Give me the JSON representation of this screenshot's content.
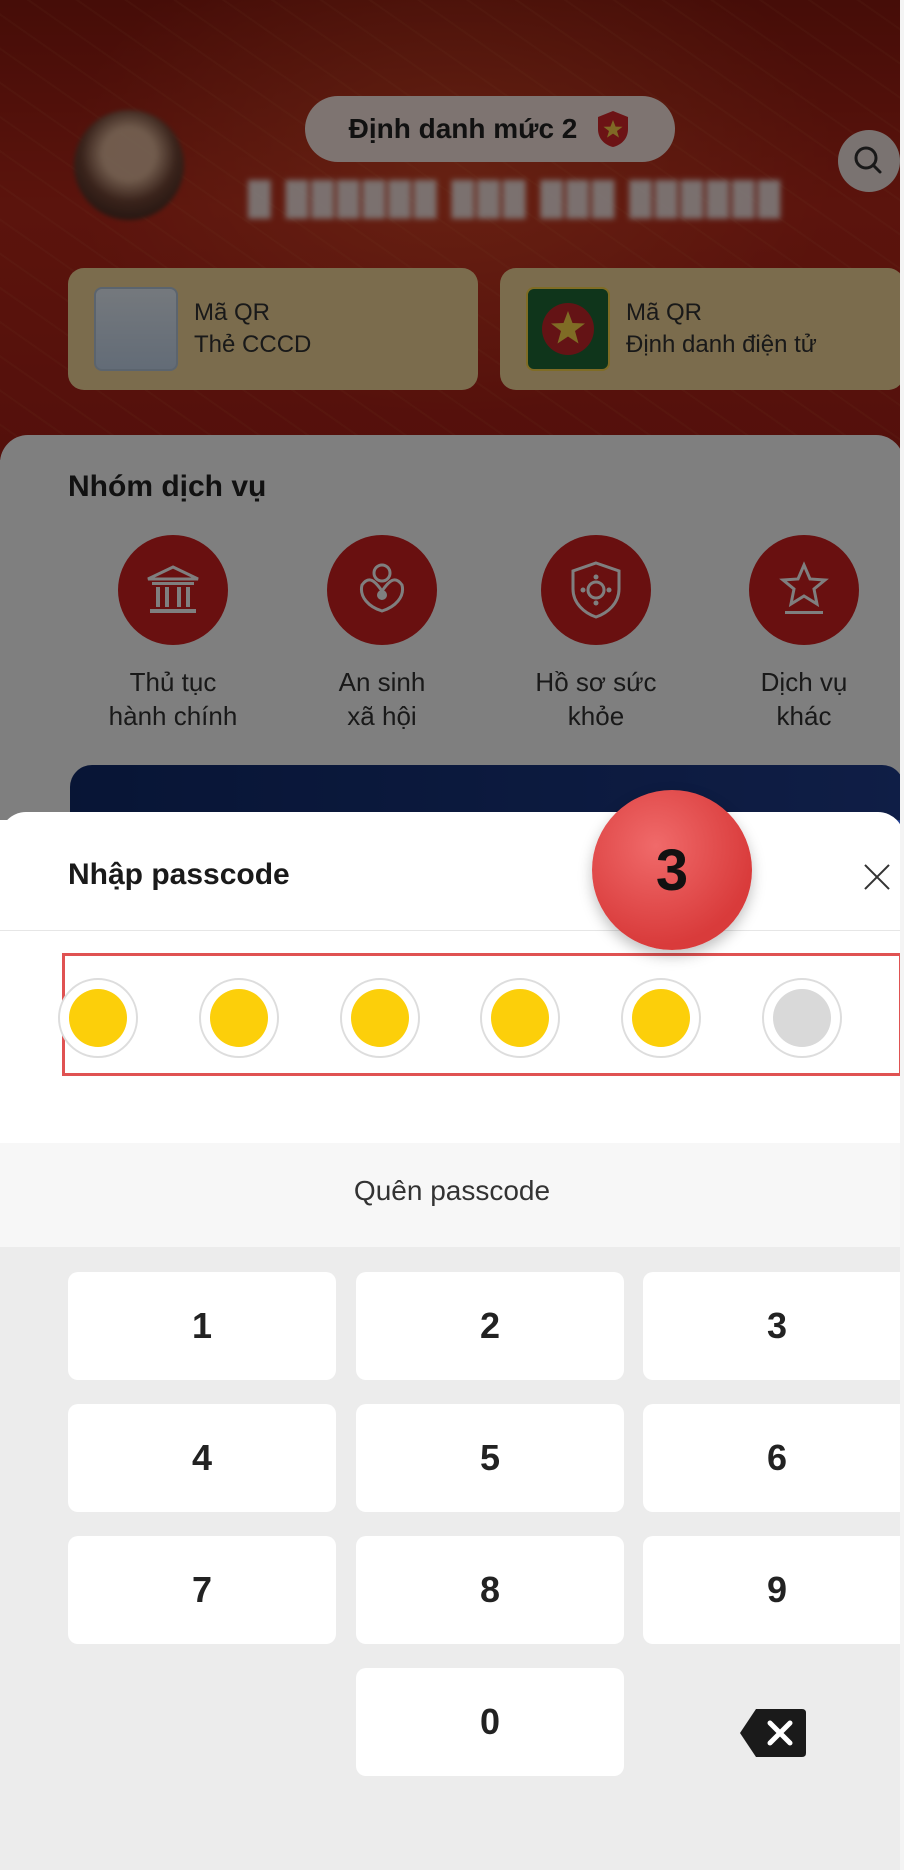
{
  "header": {
    "level_label": "Định danh mức 2"
  },
  "qr_cards": [
    {
      "title": "Mã QR",
      "subtitle": "Thẻ CCCD"
    },
    {
      "title": "Mã QR",
      "subtitle": "Định danh điện tử"
    }
  ],
  "services": {
    "title": "Nhóm dịch vụ",
    "items": [
      {
        "line1": "Thủ tục",
        "line2": "hành chính",
        "icon": "bank-icon"
      },
      {
        "line1": "An sinh",
        "line2": "xã hội",
        "icon": "family-icon"
      },
      {
        "line1": "Hồ sơ sức",
        "line2": "khỏe",
        "icon": "virus-shield-icon"
      },
      {
        "line1": "Dịch vụ",
        "line2": "khác",
        "icon": "star-icon"
      }
    ]
  },
  "passcode_sheet": {
    "title": "Nhập passcode",
    "step_badge": "3",
    "entered_digits": 5,
    "total_digits": 6,
    "filled_color": "#fccf0a",
    "empty_color": "#d9d9d9",
    "forgot_label": "Quên passcode"
  },
  "keypad": {
    "keys": [
      "1",
      "2",
      "3",
      "4",
      "5",
      "6",
      "7",
      "8",
      "9",
      "0"
    ]
  },
  "colors": {
    "header_red": "#b7281a",
    "service_red": "#d32020",
    "highlight_border": "#e05252",
    "badge_red": "#d93b3b"
  }
}
